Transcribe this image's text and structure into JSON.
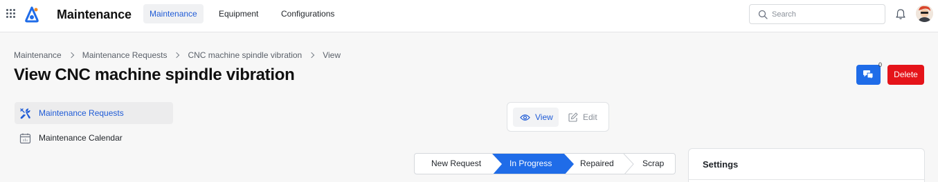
{
  "app": {
    "title": "Maintenance",
    "nav_tabs": [
      {
        "label": "Maintenance",
        "active": true
      },
      {
        "label": "Equipment",
        "active": false
      },
      {
        "label": "Configurations",
        "active": false
      }
    ],
    "search": {
      "placeholder": "Search",
      "value": ""
    }
  },
  "breadcrumb": [
    "Maintenance",
    "Maintenance Requests",
    "CNC machine spindle vibration",
    "View"
  ],
  "page_title": "View CNC machine spindle vibration",
  "actions": {
    "comment_count": "0",
    "delete_label": "Delete"
  },
  "sidebar": {
    "items": [
      {
        "label": "Maintenance Requests",
        "icon": "tools-icon",
        "active": true
      },
      {
        "label": "Maintenance Calendar",
        "icon": "calendar-icon",
        "active": false
      }
    ]
  },
  "mode_toggle": {
    "view_label": "View",
    "edit_label": "Edit",
    "active": "view"
  },
  "pipeline": {
    "stages": [
      "New Request",
      "In Progress",
      "Repaired",
      "Scrap"
    ],
    "active_index": 1
  },
  "settings": {
    "title": "Settings"
  },
  "colors": {
    "accent": "#1f5bd6",
    "primary_button": "#1f6ce8",
    "danger": "#e5141a",
    "active_stage": "#1f6ce8"
  }
}
